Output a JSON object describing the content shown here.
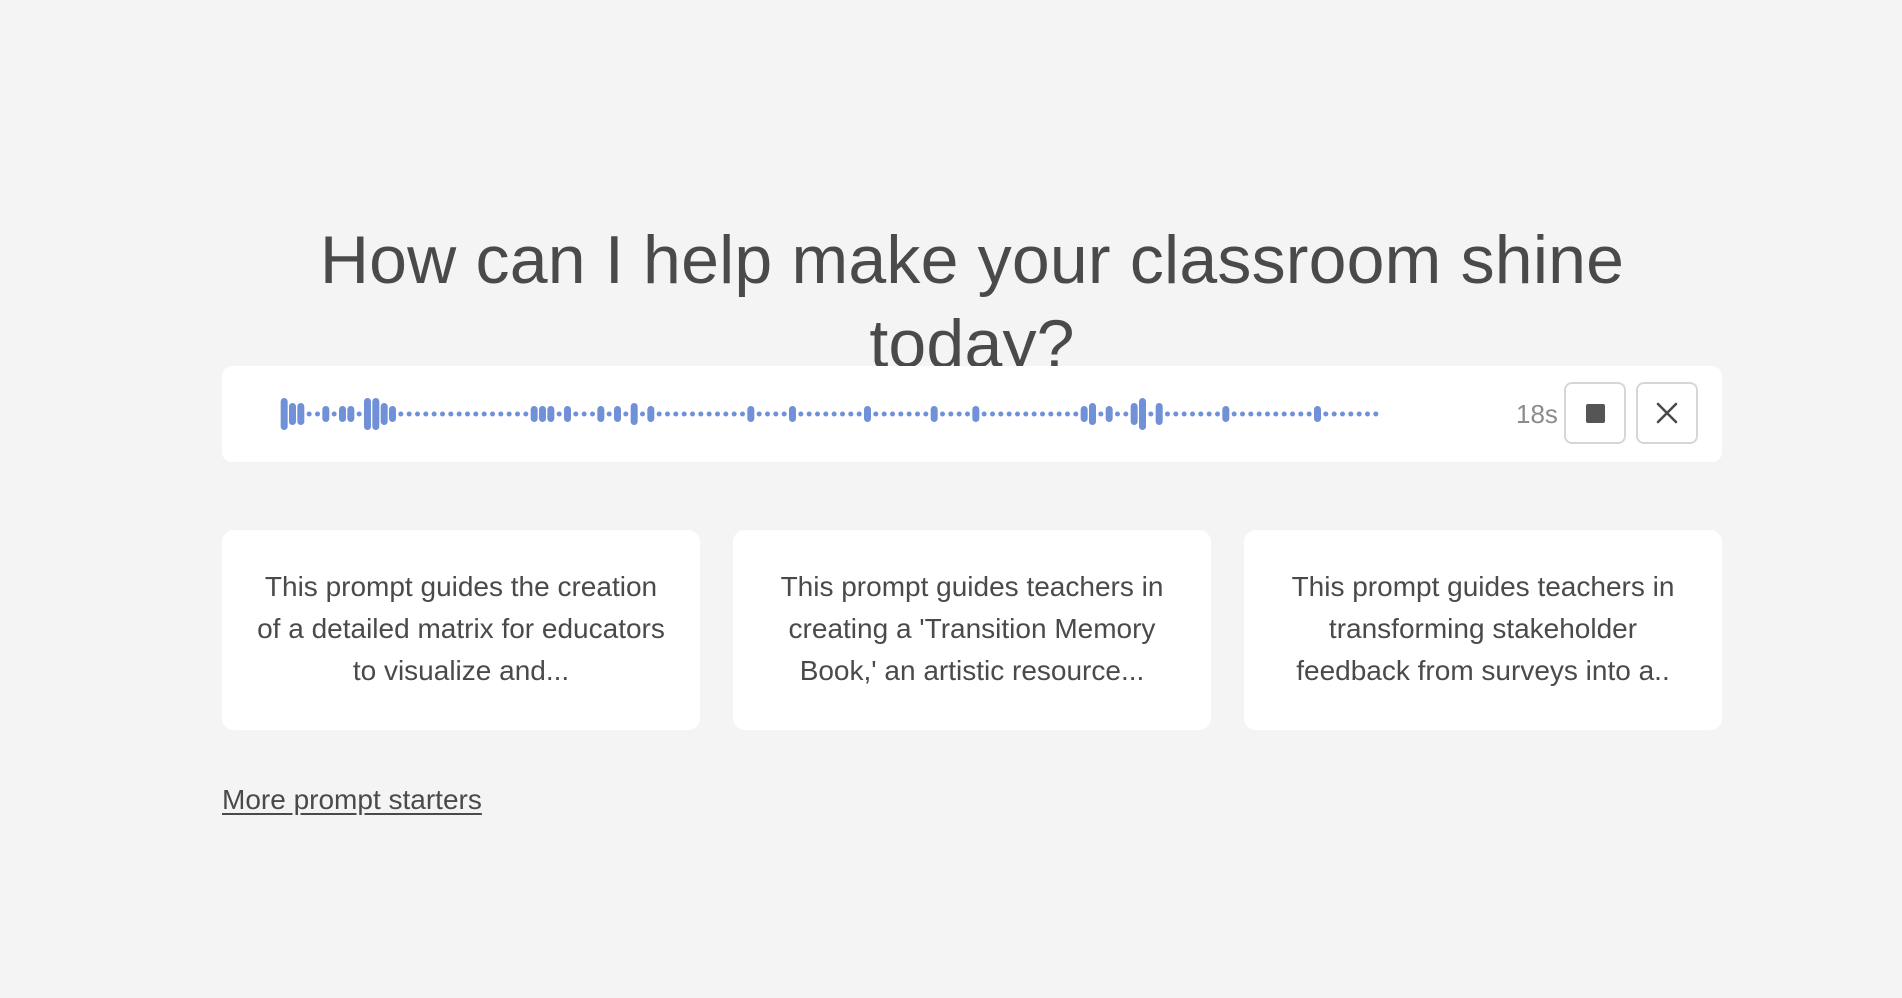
{
  "heading": "How can I help make your classroom shine today?",
  "recorder": {
    "elapsed": "18s",
    "waveform_color": "#7090d8",
    "waveform_levels": [
      3,
      2,
      2,
      0,
      0,
      1,
      0,
      1,
      1,
      0,
      3,
      3,
      2,
      1,
      0,
      0,
      0,
      0,
      0,
      0,
      0,
      0,
      0,
      0,
      0,
      0,
      0,
      0,
      0,
      0,
      1,
      1,
      1,
      0,
      1,
      0,
      0,
      0,
      1,
      0,
      1,
      0,
      2,
      0,
      1,
      0,
      0,
      0,
      0,
      0,
      0,
      0,
      0,
      0,
      0,
      0,
      1,
      0,
      0,
      0,
      0,
      1,
      0,
      0,
      0,
      0,
      0,
      0,
      0,
      0,
      1,
      0,
      0,
      0,
      0,
      0,
      0,
      0,
      1,
      0,
      0,
      0,
      0,
      1,
      0,
      0,
      0,
      0,
      0,
      0,
      0,
      0,
      0,
      0,
      0,
      0,
      1,
      2,
      0,
      1,
      0,
      0,
      2,
      3,
      0,
      2,
      0,
      0,
      0,
      0,
      0,
      0,
      0,
      1,
      0,
      0,
      0,
      0,
      0,
      0,
      0,
      0,
      0,
      0,
      1,
      0,
      0,
      0,
      0,
      0,
      0,
      0
    ],
    "stop_icon": "stop-square-icon",
    "close_icon": "x-close-icon"
  },
  "prompt_cards": [
    {
      "text": "This prompt guides the creation of a detailed matrix for educators to visualize and..."
    },
    {
      "text": "This prompt guides teachers in creating a 'Transition Memory Book,' an artistic resource..."
    },
    {
      "text": "This prompt guides teachers in transforming stakeholder feedback from surveys into a.."
    }
  ],
  "more_prompts_label": "More prompt starters"
}
